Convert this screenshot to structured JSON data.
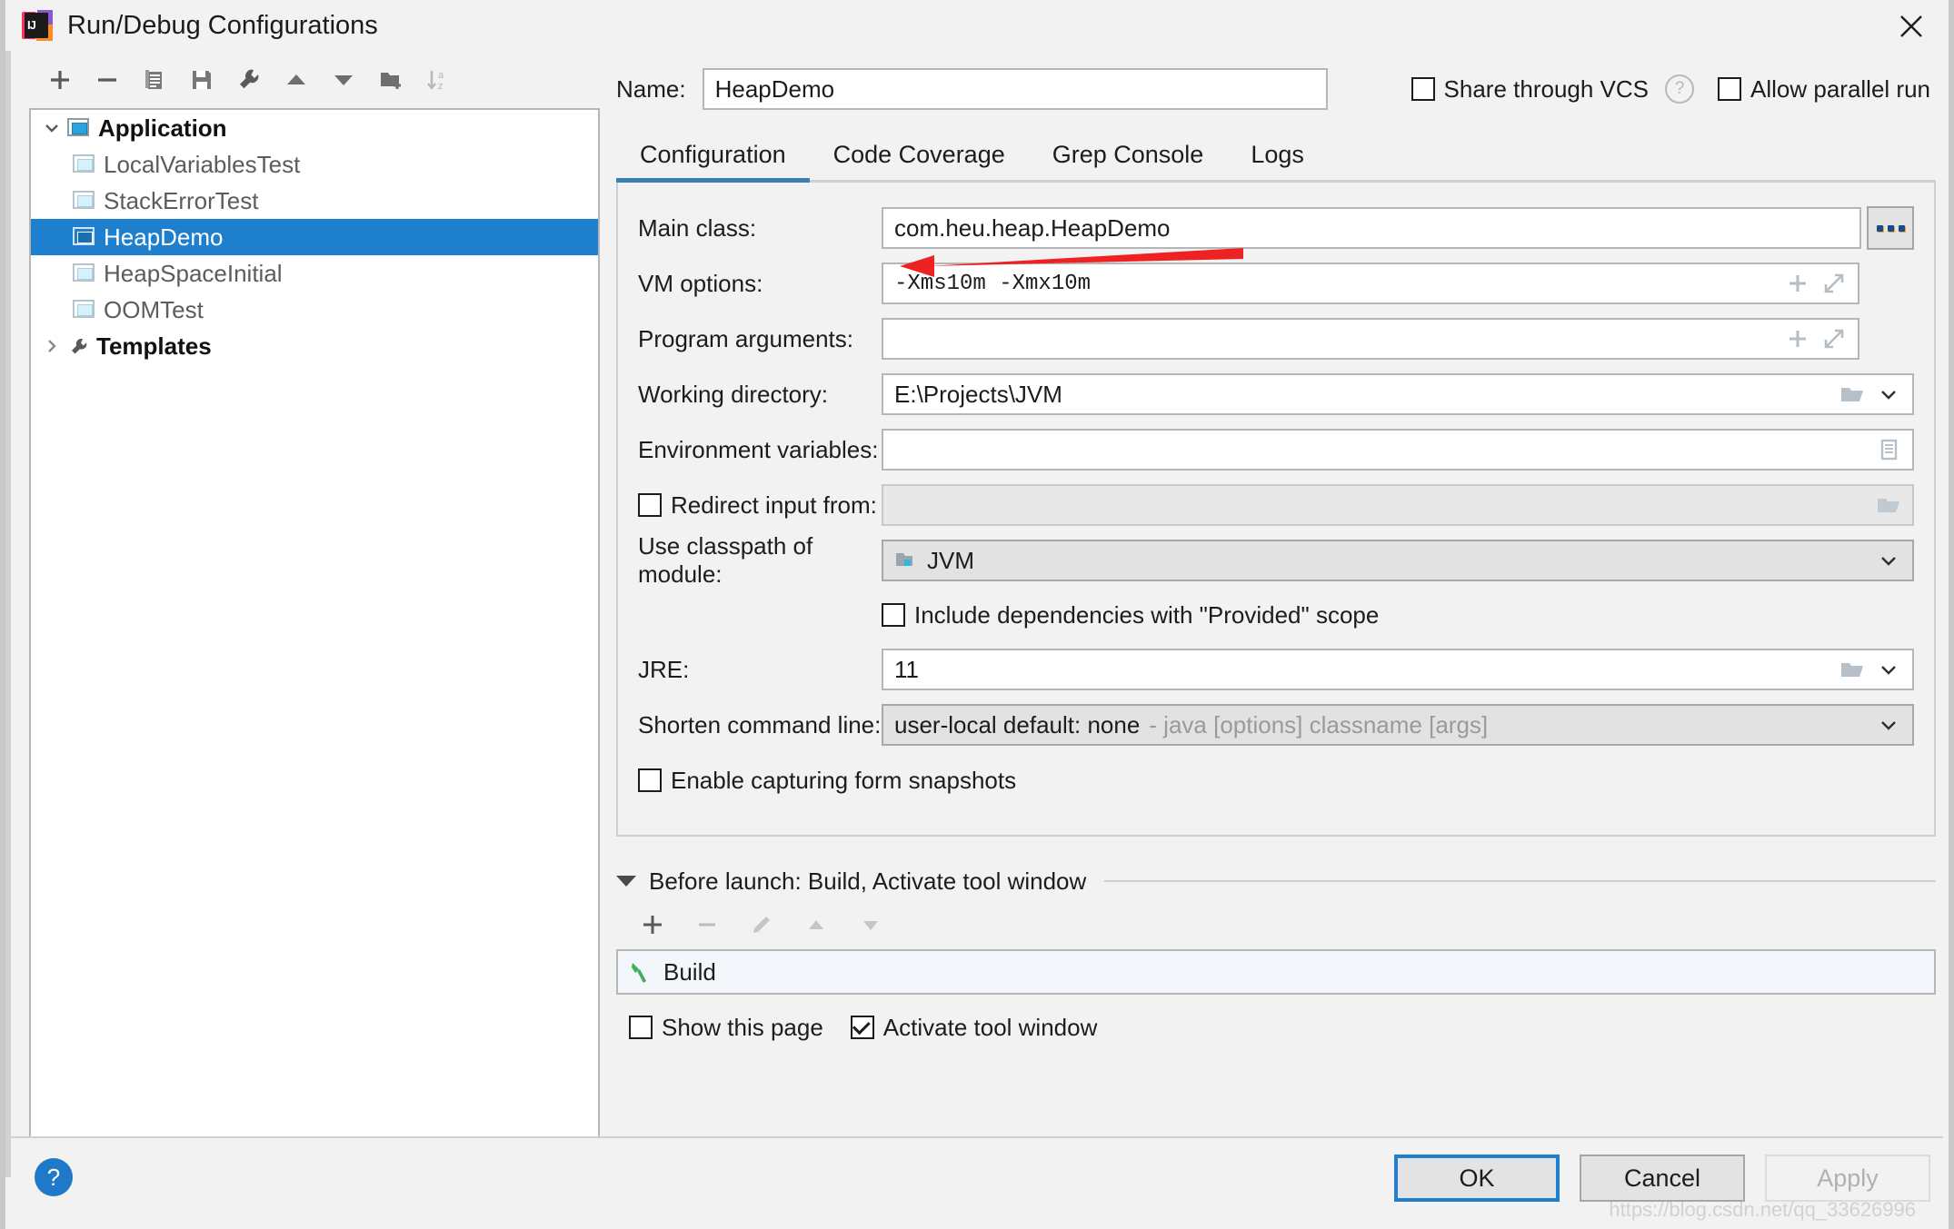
{
  "window": {
    "title": "Run/Debug Configurations",
    "logo_text": "IJ",
    "close_icon": "close-icon"
  },
  "tree_toolbar": [
    {
      "name": "add-configuration-button",
      "icon": "plus-icon"
    },
    {
      "name": "remove-configuration-button",
      "icon": "minus-icon"
    },
    {
      "name": "copy-configuration-button",
      "icon": "copy-icon"
    },
    {
      "name": "save-configuration-button",
      "icon": "save-icon"
    },
    {
      "name": "edit-templates-button",
      "icon": "wrench-icon"
    },
    {
      "name": "move-up-button",
      "icon": "arrow-up-icon"
    },
    {
      "name": "move-down-button",
      "icon": "arrow-down-icon"
    },
    {
      "name": "create-folder-button",
      "icon": "new-folder-icon"
    },
    {
      "name": "sort-alphabetically-button",
      "icon": "sort-az-icon"
    }
  ],
  "tree": {
    "root": {
      "label": "Application",
      "expanded": true
    },
    "children": [
      {
        "label": "LocalVariablesTest",
        "selected": false
      },
      {
        "label": "StackErrorTest",
        "selected": false
      },
      {
        "label": "HeapDemo",
        "selected": true
      },
      {
        "label": "HeapSpaceInitial",
        "selected": false
      },
      {
        "label": "OOMTest",
        "selected": false
      }
    ],
    "templates": {
      "label": "Templates",
      "expanded": false
    }
  },
  "header": {
    "name_label": "Name:",
    "name_value": "HeapDemo",
    "share_vcs_label": "Share through VCS",
    "share_vcs_checked": false,
    "help_icon": "question-mark-icon",
    "allow_parallel_label": "Allow parallel run",
    "allow_parallel_checked": false
  },
  "tabs": [
    {
      "label": "Configuration",
      "active": true
    },
    {
      "label": "Code Coverage",
      "active": false
    },
    {
      "label": "Grep Console",
      "active": false
    },
    {
      "label": "Logs",
      "active": false
    }
  ],
  "form": {
    "main_class": {
      "label": "Main class:",
      "value": "com.heu.heap.HeapDemo",
      "browse_label": "..."
    },
    "vm_options": {
      "label": "VM options:",
      "value": "-Xms10m  -Xmx10m",
      "add_icon": "plus-icon",
      "expand_icon": "expand-icon"
    },
    "program_arguments": {
      "label": "Program arguments:",
      "value": "",
      "add_icon": "plus-icon",
      "expand_icon": "expand-icon"
    },
    "working_directory": {
      "label": "Working directory:",
      "value": "E:\\Projects\\JVM",
      "folder_icon": "folder-icon",
      "dropdown_icon": "chevron-down-icon"
    },
    "environment_variables": {
      "label": "Environment variables:",
      "value": "",
      "list_icon": "list-edit-icon"
    },
    "redirect_input": {
      "label": "Redirect input from:",
      "checked": false,
      "value": "",
      "folder_icon": "folder-icon"
    },
    "classpath_module": {
      "label": "Use classpath of module:",
      "value": "JVM",
      "module_icon": "module-icon",
      "dropdown_icon": "chevron-down-icon"
    },
    "include_provided": {
      "label": "Include dependencies with \"Provided\" scope",
      "checked": false
    },
    "jre": {
      "label": "JRE:",
      "value": "11",
      "folder_icon": "folder-icon",
      "dropdown_icon": "chevron-down-icon"
    },
    "shorten_command_line": {
      "label": "Shorten command line:",
      "value": "user-local default: none",
      "hint": "- java [options] classname [args]",
      "dropdown_icon": "chevron-down-icon"
    },
    "enable_capturing": {
      "label": "Enable capturing form snapshots",
      "checked": false
    }
  },
  "before_launch": {
    "title": "Before launch: Build, Activate tool window",
    "toolbar": [
      {
        "name": "add-task-button",
        "icon": "plus-icon",
        "enabled": true
      },
      {
        "name": "remove-task-button",
        "icon": "minus-icon",
        "enabled": false
      },
      {
        "name": "edit-task-button",
        "icon": "pencil-icon",
        "enabled": false
      },
      {
        "name": "move-task-up-button",
        "icon": "arrow-up-icon",
        "enabled": false
      },
      {
        "name": "move-task-down-button",
        "icon": "arrow-down-icon",
        "enabled": false
      }
    ],
    "items": [
      {
        "label": "Build",
        "icon": "build-hammer-icon"
      }
    ],
    "show_this_page": {
      "label": "Show this page",
      "checked": false
    },
    "activate_tool_window": {
      "label": "Activate tool window",
      "checked": true
    }
  },
  "footer": {
    "help_icon": "question-mark-icon",
    "ok_label": "OK",
    "cancel_label": "Cancel",
    "apply_label": "Apply",
    "apply_enabled": false
  },
  "annotation": {
    "arrow_color": "#ee2222",
    "target": "vm-options-field"
  },
  "watermark": "https://blog.csdn.net/qq_33626996",
  "colors": {
    "selection_blue": "#1e7fce",
    "tab_underline": "#3c7fb1",
    "dialog_bg": "#f2f2f2",
    "field_bg": "#ffffff",
    "disabled_bg": "#e8e8e8"
  }
}
